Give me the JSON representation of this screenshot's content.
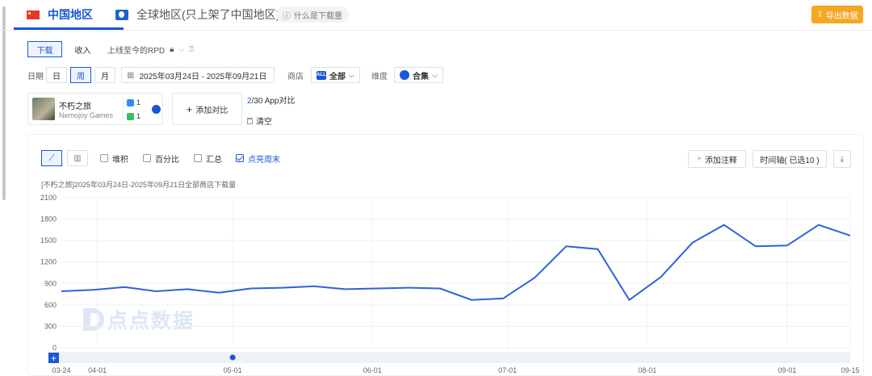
{
  "tabs": {
    "china": "中国地区",
    "global": "全球地区(只上架了中国地区)",
    "what_is": "什么是下载量",
    "export": "导出数据"
  },
  "metric": {
    "download": "下载",
    "revenue": "收入",
    "rpd": "上线至今的RPD"
  },
  "date": {
    "label": "日期",
    "day": "日",
    "week": "周",
    "month": "月",
    "range": "2025年03月24日  -  2025年09月21日",
    "store_label": "商店",
    "store_value": "全部",
    "store_badge": "ALL",
    "dim_label": "维度",
    "dim_value": "合集"
  },
  "app": {
    "name": "不朽之旅",
    "developer": "Nemojoy Games",
    "ios_count": "1",
    "android_count": "1"
  },
  "compare": {
    "add": "添加对比",
    "count_current": "2",
    "count_rest": "/30 App对比",
    "clear": "清空"
  },
  "chart_controls": {
    "stacked": "堆积",
    "percent": "百分比",
    "summary": "汇总",
    "weekend": "点亮周末",
    "add_note": "添加注释",
    "timeline": "时间轴( 已选10 )"
  },
  "watermark": "点点数据",
  "chart_data": {
    "type": "line",
    "title": "[不朽之旅]2025年03月24日-2025年09月21日全部商店下载量",
    "xlabel": "",
    "ylabel": "",
    "ylim": [
      0,
      2100
    ],
    "yticks": [
      0,
      300,
      600,
      900,
      1200,
      1500,
      1800,
      2100
    ],
    "x_tick_labels": [
      "03-24",
      "04-01",
      "05-01",
      "06-01",
      "07-01",
      "08-01",
      "09-01",
      "09-15"
    ],
    "x_tick_dates": [
      "2025-03-24",
      "2025-04-01",
      "2025-05-01",
      "2025-06-01",
      "2025-07-01",
      "2025-08-01",
      "2025-09-01",
      "2025-09-15"
    ],
    "grid": true,
    "series": [
      {
        "color": "#2e62d9",
        "x": [
          "2025-03-24",
          "2025-03-31",
          "2025-04-07",
          "2025-04-14",
          "2025-04-21",
          "2025-04-28",
          "2025-05-05",
          "2025-05-12",
          "2025-05-19",
          "2025-05-26",
          "2025-06-02",
          "2025-06-09",
          "2025-06-16",
          "2025-06-23",
          "2025-06-30",
          "2025-07-07",
          "2025-07-14",
          "2025-07-21",
          "2025-07-28",
          "2025-08-04",
          "2025-08-11",
          "2025-08-18",
          "2025-08-25",
          "2025-09-01",
          "2025-09-08",
          "2025-09-15"
        ],
        "values": [
          790,
          810,
          850,
          790,
          820,
          770,
          830,
          840,
          860,
          820,
          830,
          840,
          830,
          670,
          690,
          980,
          1420,
          1380,
          670,
          990,
          1470,
          1720,
          1420,
          1430,
          1720,
          1570
        ]
      }
    ]
  }
}
